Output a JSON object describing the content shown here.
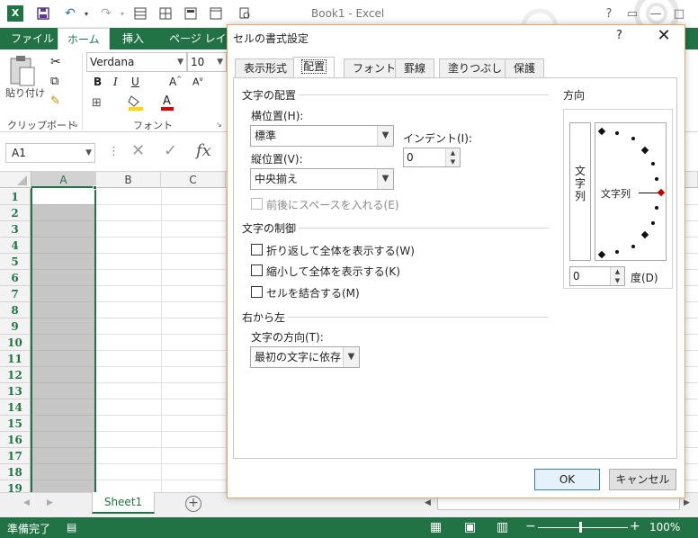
{
  "window": {
    "app_title": "Book1 - Excel"
  },
  "ribbon": {
    "tabs": [
      "ファイル",
      "ホーム",
      "挿入",
      "ページ レイア"
    ],
    "active_tab": "ホーム",
    "paste_label": "貼り付け",
    "clipboard_label": "クリップボード",
    "font_label": "フォント",
    "font_name": "Verdana",
    "font_size": "10"
  },
  "formula_bar": {
    "name_box": "A1",
    "fx": "fx"
  },
  "grid": {
    "columns": [
      "A",
      "B",
      "C"
    ],
    "rows": [
      "1",
      "2",
      "3",
      "4",
      "5",
      "6",
      "7",
      "8",
      "9",
      "10",
      "11",
      "12",
      "13",
      "14",
      "15",
      "16",
      "17",
      "18",
      "19"
    ]
  },
  "sheets": {
    "tabs": [
      "Sheet1"
    ]
  },
  "status": {
    "ready": "準備完了",
    "zoom": "100%"
  },
  "dialog": {
    "title": "セルの書式設定",
    "help": "?",
    "tabs": [
      "表示形式",
      "配置",
      "フォント",
      "罫線",
      "塗りつぶし",
      "保護"
    ],
    "active_tab": "配置",
    "text_alignment": {
      "group": "文字の配置",
      "horizontal_label": "横位置(H):",
      "horizontal_value": "標準",
      "vertical_label": "縦位置(V):",
      "vertical_value": "中央揃え",
      "indent_label": "インデント(I):",
      "indent_value": "0",
      "justify_distributed_label": "前後にスペースを入れる(E)"
    },
    "text_control": {
      "group": "文字の制御",
      "wrap_label": "折り返して全体を表示する(W)",
      "shrink_label": "縮小して全体を表示する(K)",
      "merge_label": "セルを結合する(M)"
    },
    "rtl": {
      "group": "右から左",
      "direction_label": "文字の方向(T):",
      "direction_value": "最初の文字に依存"
    },
    "orientation": {
      "group": "方向",
      "vertical_text": [
        "文",
        "字",
        "列"
      ],
      "preview_text": "文字列",
      "degrees_value": "0",
      "degrees_label": "度(D)"
    },
    "ok_label": "OK",
    "cancel_label": "キャンセル"
  },
  "colors": {
    "excel_green": "#217346",
    "dialog_border": "#e3a86e",
    "selection_gray": "#c6c6c6"
  }
}
